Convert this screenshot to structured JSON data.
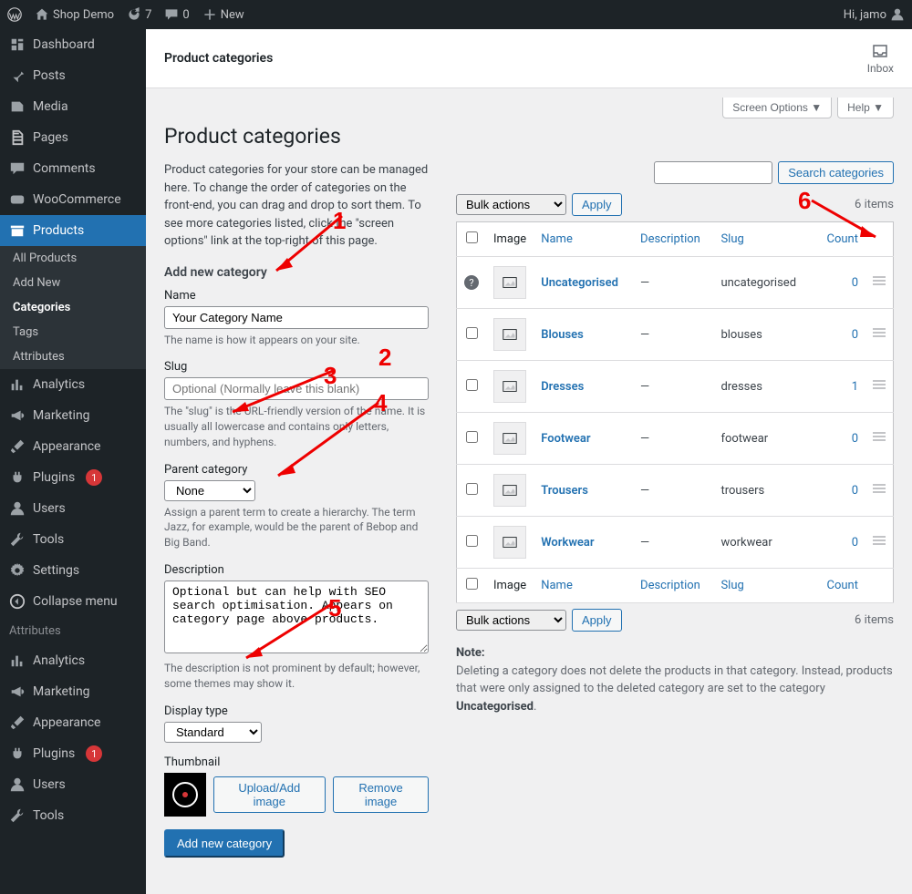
{
  "adminbar": {
    "site": "Shop Demo",
    "updates": "7",
    "comments": "0",
    "new": "New",
    "greeting": "Hi, jamo"
  },
  "sidebar": {
    "items": [
      {
        "label": "Dashboard",
        "icon": "dashboard"
      },
      {
        "label": "Posts",
        "icon": "pin"
      },
      {
        "label": "Media",
        "icon": "media"
      },
      {
        "label": "Pages",
        "icon": "pages"
      },
      {
        "label": "Comments",
        "icon": "comment"
      },
      {
        "label": "WooCommerce",
        "icon": "woo"
      },
      {
        "label": "Products",
        "icon": "archive",
        "current": true
      },
      {
        "label": "Analytics",
        "icon": "chart"
      },
      {
        "label": "Marketing",
        "icon": "megaphone"
      },
      {
        "label": "Appearance",
        "icon": "brush"
      },
      {
        "label": "Plugins",
        "icon": "plug",
        "badge": "1"
      },
      {
        "label": "Users",
        "icon": "user"
      },
      {
        "label": "Tools",
        "icon": "wrench"
      },
      {
        "label": "Settings",
        "icon": "cog"
      },
      {
        "label": "Collapse menu",
        "icon": "collapse"
      }
    ],
    "submenu": [
      "All Products",
      "Add New",
      "Categories",
      "Tags",
      "Attributes"
    ],
    "submenu_current": "Categories",
    "extra_heading": "Attributes",
    "extra": [
      {
        "label": "Analytics",
        "icon": "chart"
      },
      {
        "label": "Marketing",
        "icon": "megaphone"
      },
      {
        "label": "Appearance",
        "icon": "brush"
      },
      {
        "label": "Plugins",
        "icon": "plug",
        "badge": "1"
      },
      {
        "label": "Users",
        "icon": "user"
      },
      {
        "label": "Tools",
        "icon": "wrench"
      }
    ]
  },
  "pagehead": {
    "crumb": "Product categories",
    "inbox": "Inbox"
  },
  "screen": {
    "options": "Screen Options ▼",
    "help": "Help ▼"
  },
  "page": {
    "title": "Product categories",
    "intro": "Product categories for your store can be managed here. To change the order of categories on the front-end, you can drag and drop to sort them. To see more categories listed, click the \"screen options\" link at the top-right of this page.",
    "add_heading": "Add new category"
  },
  "form": {
    "name_label": "Name",
    "name_value": "Your Category Name",
    "name_desc": "The name is how it appears on your site.",
    "slug_label": "Slug",
    "slug_placeholder": "Optional (Normally leave this blank)",
    "slug_desc": "The \"slug\" is the URL-friendly version of the name. It is usually all lowercase and contains only letters, numbers, and hyphens.",
    "parent_label": "Parent category",
    "parent_value": "None",
    "parent_desc": "Assign a parent term to create a hierarchy. The term Jazz, for example, would be the parent of Bebop and Big Band.",
    "desc_label": "Description",
    "desc_value": "Optional but can help with SEO search optimisation. Appears on category page above products.",
    "desc_desc": "The description is not prominent by default; however, some themes may show it.",
    "display_label": "Display type",
    "display_value": "Standard",
    "thumb_label": "Thumbnail",
    "upload_btn": "Upload/Add image",
    "remove_btn": "Remove image",
    "submit": "Add new category"
  },
  "list": {
    "bulk": "Bulk actions",
    "apply": "Apply",
    "count_text": "6 items",
    "search_btn": "Search categories",
    "headers": {
      "image": "Image",
      "name": "Name",
      "description": "Description",
      "slug": "Slug",
      "count": "Count"
    },
    "rows": [
      {
        "name": "Uncategorised",
        "desc": "—",
        "slug": "uncategorised",
        "count": "0",
        "help": true
      },
      {
        "name": "Blouses",
        "desc": "—",
        "slug": "blouses",
        "count": "0"
      },
      {
        "name": "Dresses",
        "desc": "—",
        "slug": "dresses",
        "count": "1"
      },
      {
        "name": "Footwear",
        "desc": "—",
        "slug": "footwear",
        "count": "0"
      },
      {
        "name": "Trousers",
        "desc": "—",
        "slug": "trousers",
        "count": "0"
      },
      {
        "name": "Workwear",
        "desc": "—",
        "slug": "workwear",
        "count": "0"
      }
    ],
    "note_label": "Note:",
    "note": "Deleting a category does not delete the products in that category. Instead, products that were only assigned to the deleted category are set to the category ",
    "note_strong": "Uncategorised"
  },
  "annotations": [
    "1",
    "2",
    "3",
    "4",
    "5",
    "6"
  ]
}
